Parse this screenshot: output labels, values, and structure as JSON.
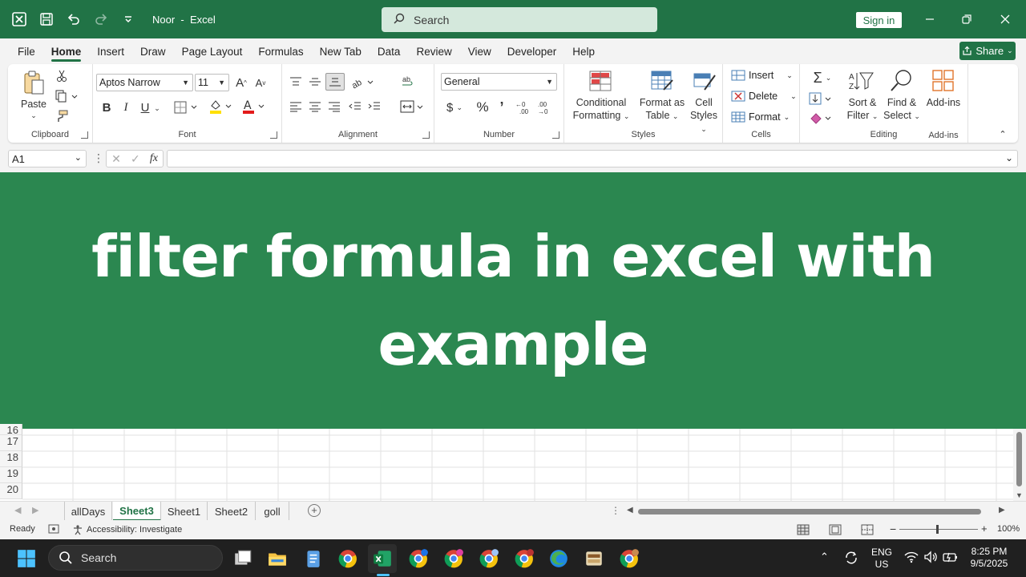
{
  "titlebar": {
    "doc_name": "Noor",
    "separator": "-",
    "app_name": "Excel",
    "search_placeholder": "Search",
    "signin_label": "Sign in"
  },
  "menu": [
    "File",
    "Home",
    "Insert",
    "Draw",
    "Page Layout",
    "Formulas",
    "New Tab",
    "Data",
    "Review",
    "View",
    "Developer",
    "Help"
  ],
  "share_label": "Share",
  "ribbon": {
    "clipboard": {
      "paste": "Paste",
      "label": "Clipboard"
    },
    "font": {
      "name": "Aptos Narrow",
      "size": "11",
      "label": "Font",
      "bold": "B",
      "italic": "I",
      "underline": "U",
      "grow": "A",
      "shrink": "A"
    },
    "alignment": {
      "label": "Alignment"
    },
    "number": {
      "format": "General",
      "label": "Number",
      "currency": "$",
      "percent": "%",
      "comma": "’"
    },
    "styles": {
      "conditional": [
        "Conditional",
        "Formatting"
      ],
      "format_table": [
        "Format as",
        "Table"
      ],
      "cell_styles": [
        "Cell",
        "Styles"
      ],
      "label": "Styles"
    },
    "cells": {
      "insert": "Insert",
      "delete": "Delete",
      "format": "Format",
      "label": "Cells"
    },
    "editing": {
      "sort": [
        "Sort &",
        "Filter"
      ],
      "find": [
        "Find &",
        "Select"
      ],
      "label": "Editing"
    },
    "addins": {
      "addins": "Add-ins",
      "label": "Add-ins"
    }
  },
  "formula_bar": {
    "name_box": "A1",
    "fx": "fx",
    "value": ""
  },
  "banner": {
    "title": "filter formula in excel with example",
    "bg": "#2b8750"
  },
  "grid": {
    "rows": [
      "16",
      "17",
      "18",
      "19",
      "20"
    ]
  },
  "sheets": [
    {
      "name": "allDays",
      "active": false
    },
    {
      "name": "Sheet3",
      "active": true
    },
    {
      "name": "Sheet1",
      "active": false
    },
    {
      "name": "Sheet2",
      "active": false
    },
    {
      "name": "goll",
      "active": false
    }
  ],
  "status": {
    "ready": "Ready",
    "accessibility": "Accessibility: Investigate",
    "zoom": "100%"
  },
  "taskbar": {
    "search": "Search",
    "lang": [
      "ENG",
      "US"
    ],
    "time": "8:25 PM",
    "date": "9/5/2025"
  },
  "colors": {
    "excel_green": "#217346",
    "accent": "#2b8750"
  }
}
